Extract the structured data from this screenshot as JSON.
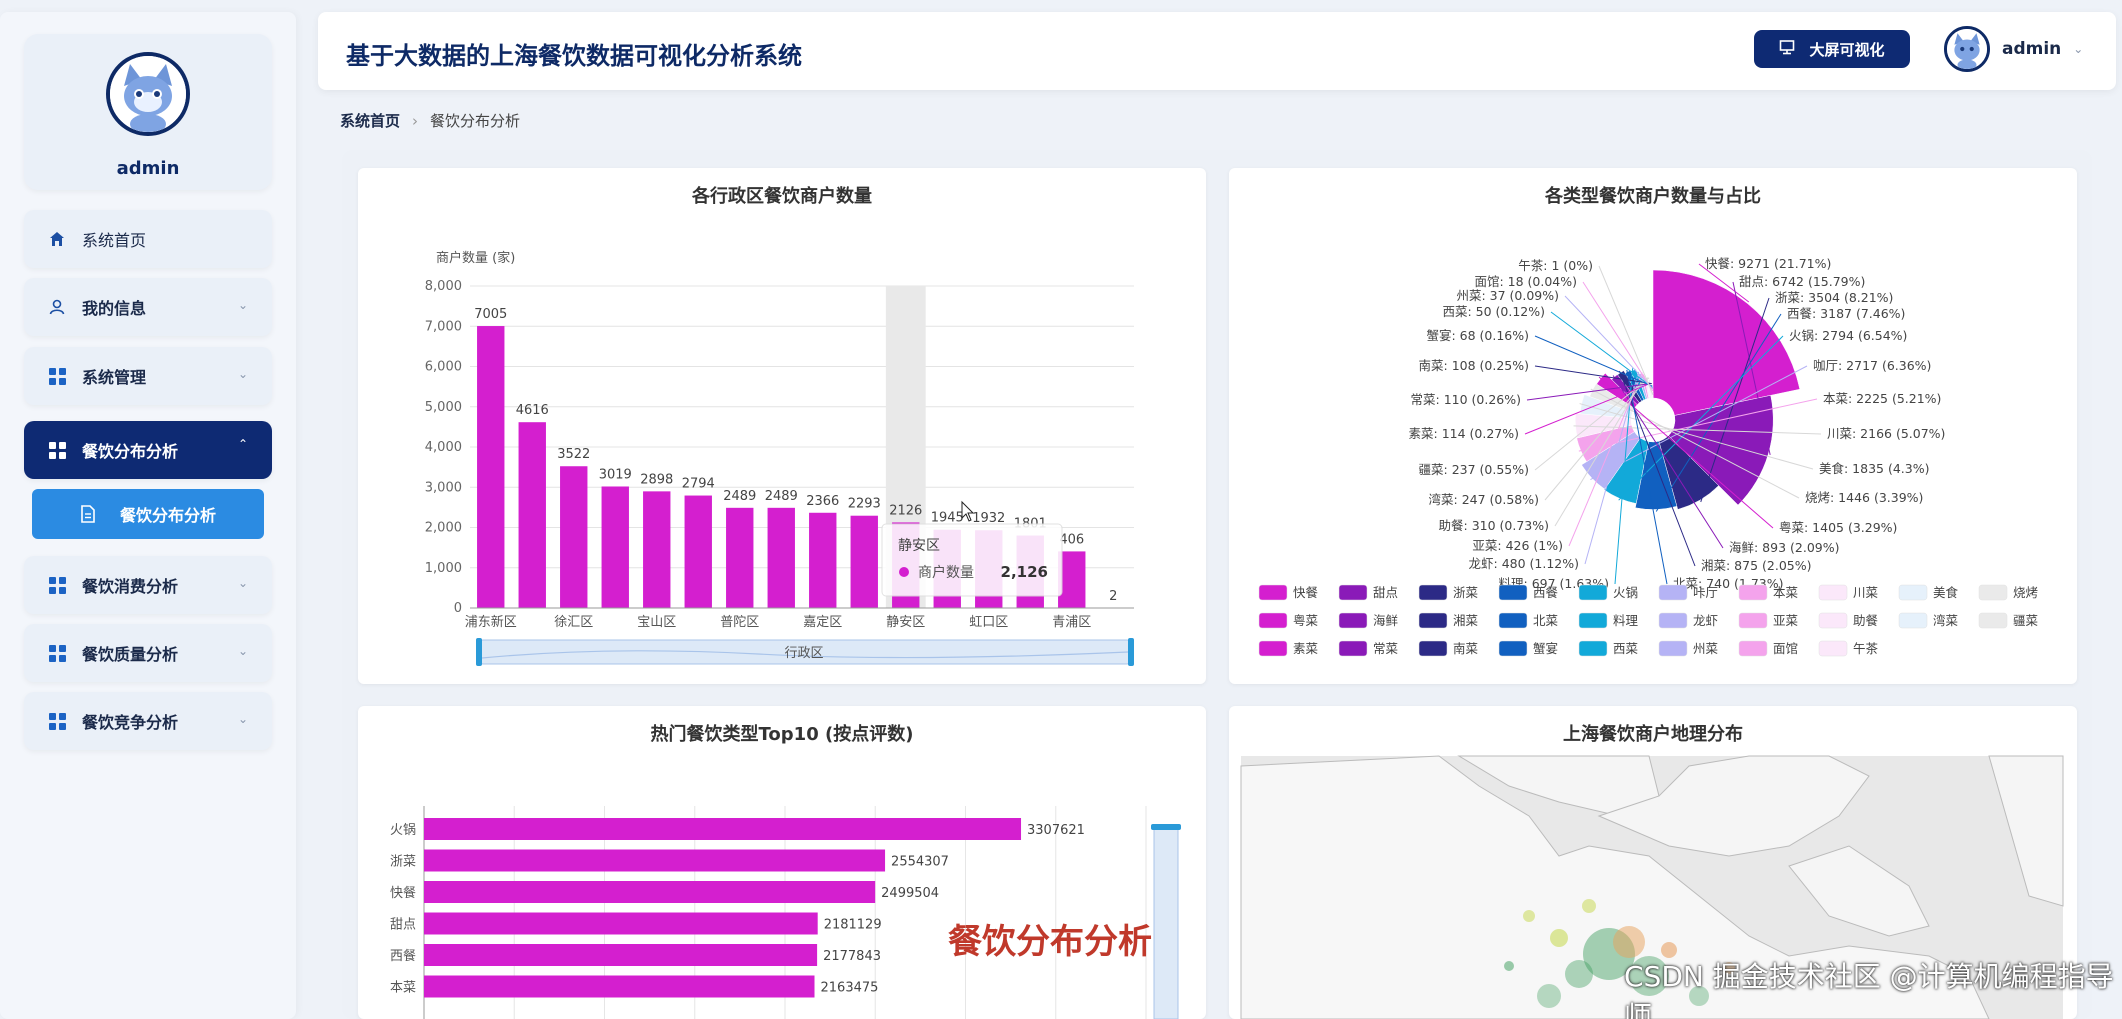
{
  "sidebar": {
    "username": "admin",
    "items": [
      {
        "label": "系统首页",
        "icon": "home-icon"
      },
      {
        "label": "我的信息",
        "icon": "user-icon"
      },
      {
        "label": "系统管理",
        "icon": "grid-icon"
      },
      {
        "label": "餐饮分布分析",
        "icon": "grid-icon"
      },
      {
        "label": "餐饮消费分析",
        "icon": "grid-icon"
      },
      {
        "label": "餐饮质量分析",
        "icon": "grid-icon"
      },
      {
        "label": "餐饮竞争分析",
        "icon": "grid-icon"
      }
    ],
    "sub_item": {
      "label": "餐饮分布分析",
      "icon": "document-icon"
    }
  },
  "header": {
    "title": "基于大数据的上海餐饮数据可视化分析系统",
    "bigscreen_label": "大屏可视化",
    "username": "admin"
  },
  "breadcrumb": {
    "home": "系统首页",
    "current": "餐饮分布分析"
  },
  "chart_data": [
    {
      "type": "bar",
      "title": "各行政区餐饮商户数量",
      "ylabel": "商户数量 (家)",
      "xlabel": "行政区",
      "ylim": [
        0,
        8000
      ],
      "yticks": [
        "0",
        "1,000",
        "2,000",
        "3,000",
        "4,000",
        "5,000",
        "6,000",
        "7,000",
        "8,000"
      ],
      "categories": [
        "浦东新区",
        "",
        "徐汇区",
        "",
        "宝山区",
        "",
        "普陀区",
        "",
        "嘉定区",
        "",
        "静安区",
        "",
        "虹口区",
        "",
        "青浦区",
        ""
      ],
      "values": [
        7005,
        4616,
        3522,
        3019,
        2898,
        2794,
        2489,
        2489,
        2366,
        2293,
        2126,
        1945,
        1932,
        1801,
        1406,
        2
      ],
      "value_labels": [
        "7005",
        "4616",
        "3522",
        "3019",
        "2898",
        "2794",
        "2489",
        "2489",
        "2366",
        "2293",
        "2126",
        "1945",
        "1932",
        "1801",
        "406",
        "2"
      ],
      "series_name": "商户数量",
      "color": "#d41fcf",
      "tooltip": {
        "title": "静安区",
        "series": "商户数量",
        "value": "2,126"
      }
    },
    {
      "type": "pie",
      "title": "各类型餐饮商户数量与占比",
      "slices": [
        {
          "name": "快餐",
          "value": 9271,
          "label": "快餐: 9271 (21.71%)",
          "color": "#d41fcf"
        },
        {
          "name": "甜点",
          "value": 6742,
          "label": "甜点: 6742 (15.79%)",
          "color": "#8a1ab8"
        },
        {
          "name": "浙菜",
          "value": 3504,
          "label": "浙菜: 3504 (8.21%)",
          "color": "#2c2a86"
        },
        {
          "name": "西餐",
          "value": 3187,
          "label": "西餐: 3187 (7.46%)",
          "color": "#1160c0"
        },
        {
          "name": "火锅",
          "value": 2794,
          "label": "火锅: 2794 (6.54%)",
          "color": "#12a9d9"
        },
        {
          "name": "咖啡厅",
          "value": 2717,
          "label": "咖厅: 2717 (6.36%)",
          "color": "#b5b3f5"
        },
        {
          "name": "本菜",
          "value": 2225,
          "label": "本菜: 2225 (5.21%)",
          "color": "#f4a3ec"
        },
        {
          "name": "川菜",
          "value": 2166,
          "label": "川菜: 2166 (5.07%)",
          "color": "#fbe8fa"
        },
        {
          "name": "美食",
          "value": 1835,
          "label": "美食: 1835 (4.3%)",
          "color": "#e6f1fb"
        },
        {
          "name": "烧烤",
          "value": 1446,
          "label": "烧烤: 1446 (3.39%)",
          "color": "#eaeaea"
        },
        {
          "name": "粤菜",
          "value": 1405,
          "label": "粤菜: 1405 (3.29%)",
          "color": "#d41fcf"
        },
        {
          "name": "海鲜",
          "value": 893,
          "label": "海鲜: 893 (2.09%)",
          "color": "#8a1ab8"
        },
        {
          "name": "湘菜",
          "value": 875,
          "label": "湘菜: 875 (2.05%)",
          "color": "#2c2a86"
        },
        {
          "name": "北菜",
          "value": 740,
          "label": "北菜: 740 (1.73%)",
          "color": "#1160c0"
        },
        {
          "name": "料理",
          "value": 697,
          "label": "料理: 697 (1.63%)",
          "color": "#12a9d9"
        },
        {
          "name": "龙虾",
          "value": 480,
          "label": "龙虾: 480 (1.12%)",
          "color": "#b5b3f5"
        },
        {
          "name": "亚菜",
          "value": 426,
          "label": "亚菜: 426 (1%)",
          "color": "#f4a3ec"
        },
        {
          "name": "助餐",
          "value": 310,
          "label": "助餐: 310 (0.73%)",
          "color": "#fbe8fa"
        },
        {
          "name": "湾菜",
          "value": 247,
          "label": "湾菜: 247 (0.58%)",
          "color": "#e6f1fb"
        },
        {
          "name": "疆菜",
          "value": 237,
          "label": "疆菜: 237 (0.55%)",
          "color": "#eaeaea"
        },
        {
          "name": "素菜",
          "value": 114,
          "label": "素菜: 114 (0.27%)",
          "color": "#d41fcf"
        },
        {
          "name": "常菜",
          "value": 110,
          "label": "常菜: 110 (0.26%)",
          "color": "#8a1ab8"
        },
        {
          "name": "南菜",
          "value": 108,
          "label": "南菜: 108 (0.25%)",
          "color": "#2c2a86"
        },
        {
          "name": "蟹宴",
          "value": 68,
          "label": "蟹宴: 68 (0.16%)",
          "color": "#1160c0"
        },
        {
          "name": "西菜",
          "value": 50,
          "label": "西菜: 50 (0.12%)",
          "color": "#12a9d9"
        },
        {
          "name": "州菜",
          "value": 37,
          "label": "州菜: 37 (0.09%)",
          "color": "#b5b3f5"
        },
        {
          "name": "面馆",
          "value": 18,
          "label": "面馆: 18 (0.04%)",
          "color": "#f4a3ec"
        },
        {
          "name": "午茶",
          "value": 1,
          "label": "午茶: 1 (0%)",
          "color": "#fbe8fa"
        }
      ],
      "legend": [
        "快餐",
        "甜点",
        "浙菜",
        "西餐",
        "火锅",
        "咔厅",
        "本菜",
        "川菜",
        "美食",
        "烧烤",
        "粤菜",
        "海鲜",
        "湘菜",
        "北菜",
        "料理",
        "龙虾",
        "亚菜",
        "助餐",
        "湾菜",
        "疆菜",
        "素菜",
        "常菜",
        "南菜",
        "蟹宴",
        "西菜",
        "州菜",
        "面馆",
        "午茶"
      ]
    },
    {
      "type": "bar",
      "orientation": "horizontal",
      "title": "热门餐饮类型Top10 (按点评数)",
      "categories": [
        "火锅",
        "浙菜",
        "快餐",
        "甜点",
        "西餐",
        "本菜"
      ],
      "values": [
        3307621,
        2554307,
        2499504,
        2181129,
        2177843,
        2163475
      ],
      "xlim": [
        0,
        4000000
      ],
      "color": "#d41fcf"
    },
    {
      "type": "map",
      "title": "上海餐饮商户地理分布"
    }
  ],
  "overlay": {
    "caption": "餐饮分布分析",
    "watermark": "CSDN 掘金技术社区 @计算机编程指导师"
  }
}
